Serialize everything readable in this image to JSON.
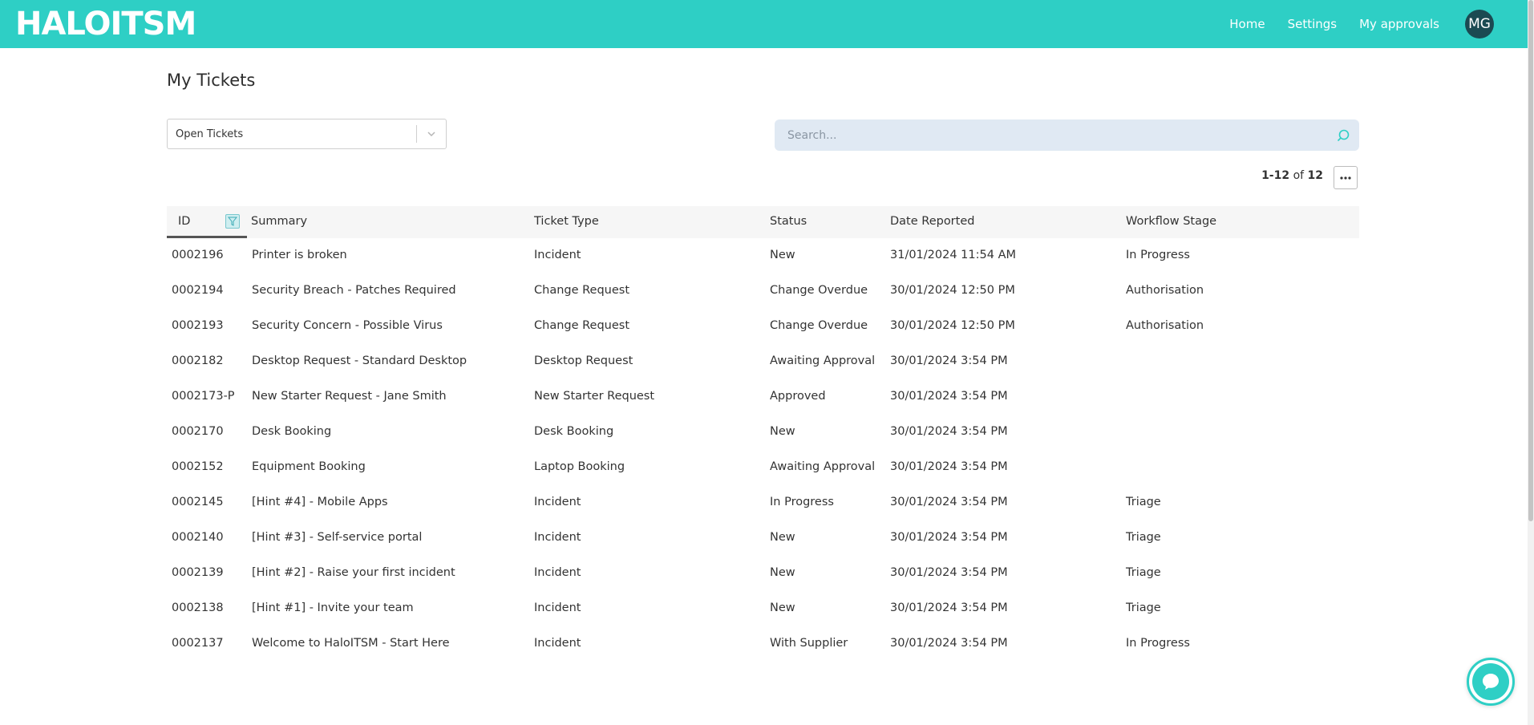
{
  "app": {
    "logo": "HALOITSM"
  },
  "nav": {
    "items": [
      "Home",
      "Settings",
      "My approvals"
    ],
    "avatar_initials": "MG"
  },
  "page": {
    "title": "My Tickets"
  },
  "filter": {
    "selected": "Open Tickets"
  },
  "search": {
    "placeholder": "Search..."
  },
  "pager": {
    "range": "1-12",
    "of": "of",
    "total": "12"
  },
  "table": {
    "headers": [
      "ID",
      "Summary",
      "Ticket Type",
      "Status",
      "Date Reported",
      "Workflow Stage"
    ],
    "rows": [
      [
        "0002196",
        "Printer is broken",
        "Incident",
        "New",
        "31/01/2024 11:54 AM",
        "In Progress"
      ],
      [
        "0002194",
        "Security Breach - Patches Required",
        "Change Request",
        "Change Overdue",
        "30/01/2024 12:50 PM",
        "Authorisation"
      ],
      [
        "0002193",
        "Security Concern - Possible Virus",
        "Change Request",
        "Change Overdue",
        "30/01/2024 12:50 PM",
        "Authorisation"
      ],
      [
        "0002182",
        "Desktop Request - Standard Desktop",
        "Desktop Request",
        "Awaiting Approval",
        "30/01/2024 3:54 PM",
        ""
      ],
      [
        "0002173-P",
        "New Starter Request - Jane Smith",
        "New Starter Request",
        "Approved",
        "30/01/2024 3:54 PM",
        ""
      ],
      [
        "0002170",
        "Desk Booking",
        "Desk Booking",
        "New",
        "30/01/2024 3:54 PM",
        ""
      ],
      [
        "0002152",
        "Equipment Booking",
        "Laptop Booking",
        "Awaiting Approval",
        "30/01/2024 3:54 PM",
        ""
      ],
      [
        "0002145",
        "[Hint #4] - Mobile Apps",
        "Incident",
        "In Progress",
        "30/01/2024 3:54 PM",
        "Triage"
      ],
      [
        "0002140",
        "[Hint #3] - Self-service portal",
        "Incident",
        "New",
        "30/01/2024 3:54 PM",
        "Triage"
      ],
      [
        "0002139",
        "[Hint #2] - Raise your first incident",
        "Incident",
        "New",
        "30/01/2024 3:54 PM",
        "Triage"
      ],
      [
        "0002138",
        "[Hint #1] - Invite your team",
        "Incident",
        "New",
        "30/01/2024 3:54 PM",
        "Triage"
      ],
      [
        "0002137",
        "Welcome to HaloITSM - Start Here",
        "Incident",
        "With Supplier",
        "30/01/2024 3:54 PM",
        "In Progress"
      ]
    ]
  },
  "colors": {
    "brand": "#2ecfc5",
    "avatar": "#1b4a52",
    "search_bg": "#e0e9f3"
  },
  "icons": {
    "filter": "filter-icon",
    "search": "search-icon",
    "chevron": "chevron-down-icon",
    "chat": "chat-icon",
    "more": "ellipsis-icon"
  }
}
